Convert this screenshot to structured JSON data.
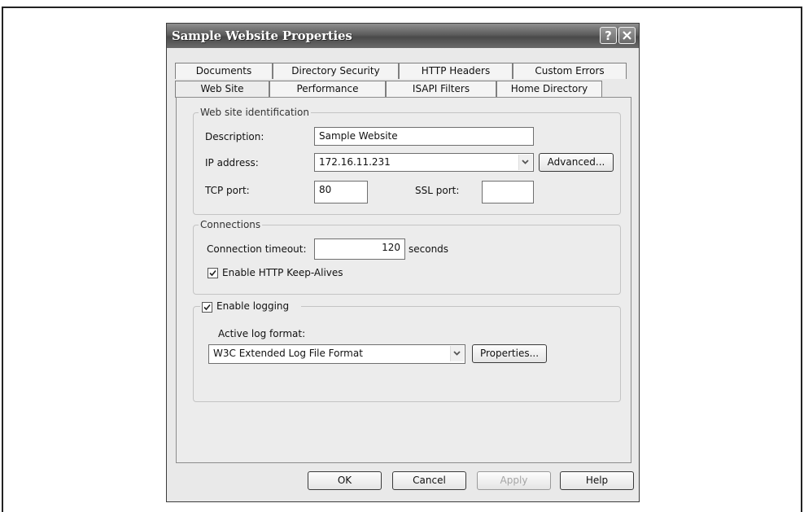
{
  "dialog": {
    "title": "Sample Website Properties",
    "help_btn": "?",
    "close_btn": "X"
  },
  "tabs": {
    "row_back": [
      "Documents",
      "Directory Security",
      "HTTP Headers",
      "Custom Errors"
    ],
    "row_front": [
      "Web Site",
      "Performance",
      "ISAPI Filters",
      "Home Directory"
    ],
    "selected": "Web Site"
  },
  "identification": {
    "group_label": "Web site identification",
    "description_label": "Description:",
    "description_value": "Sample Website",
    "ip_label": "IP address:",
    "ip_value": "172.16.11.231",
    "advanced_button": "Advanced...",
    "tcp_label": "TCP port:",
    "tcp_value": "80",
    "ssl_label": "SSL port:",
    "ssl_value": ""
  },
  "connections": {
    "group_label": "Connections",
    "timeout_label": "Connection timeout:",
    "timeout_value": "120",
    "timeout_unit": "seconds",
    "keepalive_label": "Enable HTTP Keep-Alives",
    "keepalive_checked": true
  },
  "logging": {
    "enable_label": "Enable logging",
    "enable_checked": true,
    "format_label": "Active log format:",
    "format_value": "W3C Extended Log File Format",
    "properties_button": "Properties..."
  },
  "buttons": {
    "ok": "OK",
    "cancel": "Cancel",
    "apply": "Apply",
    "help": "Help"
  }
}
